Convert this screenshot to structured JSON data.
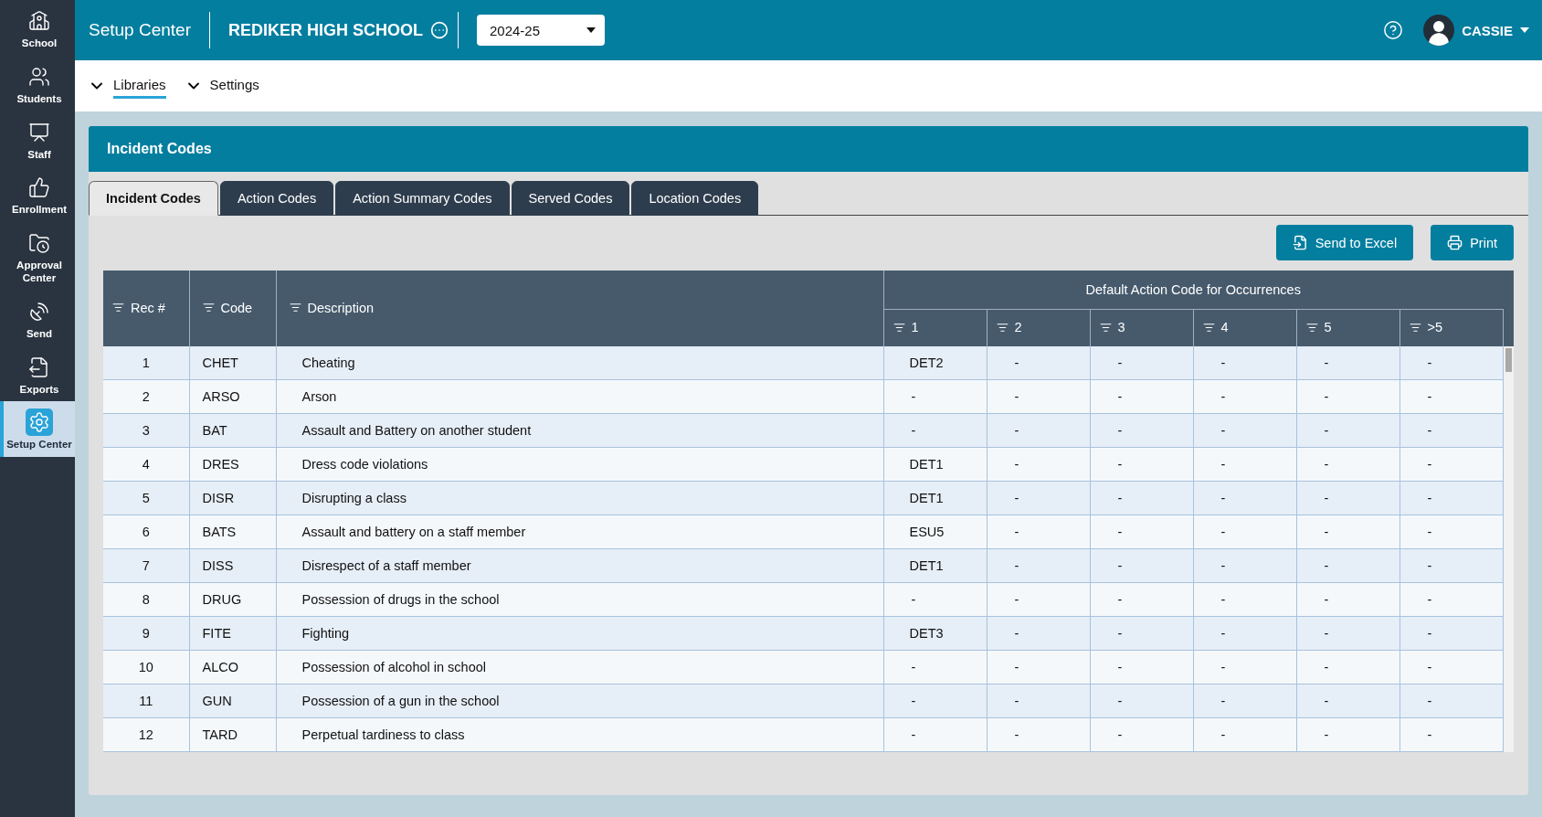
{
  "sidebar": {
    "items": [
      {
        "label": "School",
        "selected": false
      },
      {
        "label": "Students",
        "selected": false
      },
      {
        "label": "Staff",
        "selected": false
      },
      {
        "label": "Enrollment",
        "selected": false
      },
      {
        "label": "Approval Center",
        "selected": false
      },
      {
        "label": "Send",
        "selected": false
      },
      {
        "label": "Exports",
        "selected": false
      },
      {
        "label": "Setup Center",
        "selected": true
      }
    ]
  },
  "header": {
    "app_title": "Setup Center",
    "school": "REDIKER HIGH SCHOOL",
    "year": "2024-25",
    "user": "CASSIE"
  },
  "subnav": [
    {
      "label": "Libraries",
      "selected": true
    },
    {
      "label": "Settings",
      "selected": false
    }
  ],
  "panel": {
    "title": "Incident Codes",
    "tabs": [
      {
        "label": "Incident Codes",
        "selected": true
      },
      {
        "label": "Action Codes",
        "selected": false
      },
      {
        "label": "Action Summary Codes",
        "selected": false
      },
      {
        "label": "Served Codes",
        "selected": false
      },
      {
        "label": "Location Codes",
        "selected": false
      }
    ],
    "buttons": [
      {
        "label": "Send to Excel",
        "kind": "export"
      },
      {
        "label": "Print",
        "kind": "print"
      }
    ],
    "table": {
      "columns": [
        "Rec #",
        "Code",
        "Description"
      ],
      "group_header": "Default Action Code for Occurrences",
      "group_columns": [
        "1",
        "2",
        "3",
        "4",
        "5",
        ">5"
      ],
      "rows": [
        [
          "1",
          "CHET",
          "Cheating",
          "DET2",
          "-",
          "-",
          "-",
          "-",
          "-"
        ],
        [
          "2",
          "ARSO",
          "Arson",
          "-",
          "-",
          "-",
          "-",
          "-",
          "-"
        ],
        [
          "3",
          "BAT",
          "Assault and Battery on another student",
          "-",
          "-",
          "-",
          "-",
          "-",
          "-"
        ],
        [
          "4",
          "DRES",
          "Dress code violations",
          "DET1",
          "-",
          "-",
          "-",
          "-",
          "-"
        ],
        [
          "5",
          "DISR",
          "Disrupting a class",
          "DET1",
          "-",
          "-",
          "-",
          "-",
          "-"
        ],
        [
          "6",
          "BATS",
          "Assault and battery on a staff member",
          "ESU5",
          "-",
          "-",
          "-",
          "-",
          "-"
        ],
        [
          "7",
          "DISS",
          "Disrespect of a staff member",
          "DET1",
          "-",
          "-",
          "-",
          "-",
          "-"
        ],
        [
          "8",
          "DRUG",
          "Possession of drugs in the school",
          "-",
          "-",
          "-",
          "-",
          "-",
          "-"
        ],
        [
          "9",
          "FITE",
          "Fighting",
          "DET3",
          "-",
          "-",
          "-",
          "-",
          "-"
        ],
        [
          "10",
          "ALCO",
          "Possession of alcohol in school",
          "-",
          "-",
          "-",
          "-",
          "-",
          "-"
        ],
        [
          "11",
          "GUN",
          "Possession of a gun in the school",
          "-",
          "-",
          "-",
          "-",
          "-",
          "-"
        ],
        [
          "12",
          "TARD",
          "Perpetual tardiness to class",
          "-",
          "-",
          "-",
          "-",
          "-",
          "-"
        ]
      ]
    }
  }
}
